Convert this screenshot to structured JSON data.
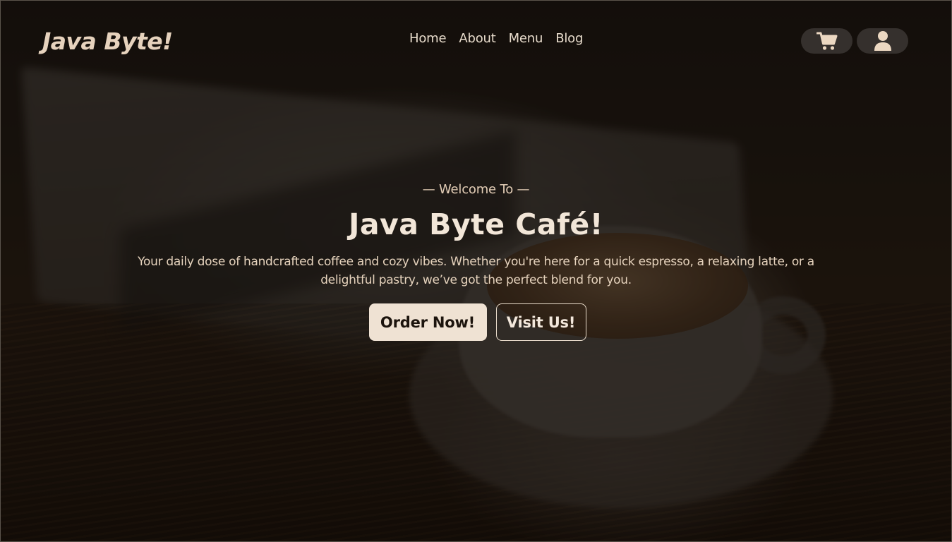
{
  "header": {
    "logo": "Java Byte!",
    "nav": [
      {
        "label": "Home"
      },
      {
        "label": "About"
      },
      {
        "label": "Menu"
      },
      {
        "label": "Blog"
      }
    ],
    "actions": [
      {
        "icon": "cart-icon"
      },
      {
        "icon": "user-icon"
      }
    ]
  },
  "hero": {
    "welcome": "— Welcome To —",
    "title": "Java Byte Café!",
    "description": "Your daily dose of handcrafted coffee and cozy vibes. Whether you're here for a quick espresso, a relaxing latte, or a delightful pastry, we’ve got the perfect blend for you.",
    "primary_button": "Order Now!",
    "secondary_button": "Visit Us!"
  },
  "colors": {
    "accent": "#efe2d3",
    "logo": "#e6d2bd",
    "overlay": "#0e0a06"
  }
}
